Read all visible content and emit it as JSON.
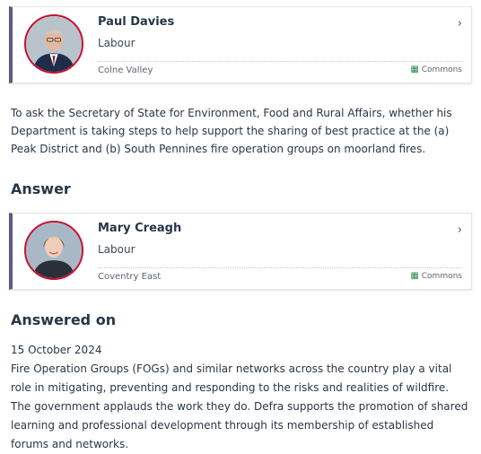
{
  "asker": {
    "name": "Paul Davies",
    "party": "Labour",
    "constituency": "Colne Valley",
    "house": "Commons",
    "avatar_icon": "portrait-photo",
    "accent_color": "#c8102e"
  },
  "question_text": "To ask the Secretary of State for Environment, Food and Rural Affairs, whether his Department is taking steps to help support the sharing of best practice at the (a) Peak District and (b) South Pennines fire operation groups on moorland fires.",
  "answer_heading": "Answer",
  "answerer": {
    "name": "Mary Creagh",
    "party": "Labour",
    "constituency": "Coventry East",
    "house": "Commons",
    "avatar_icon": "portrait-photo",
    "accent_color": "#c8102e"
  },
  "answered_heading": "Answered on",
  "answered_date": "15 October 2024",
  "answer_text": "Fire Operation Groups (FOGs) and similar networks across the country play a vital role in mitigating, preventing and responding to the risks and realities of wildfire. The government applauds the work they do. Defra supports the promotion of shared learning and professional development through its membership of established forums and networks.",
  "icons": {
    "chevron": "›",
    "house": "▦"
  }
}
